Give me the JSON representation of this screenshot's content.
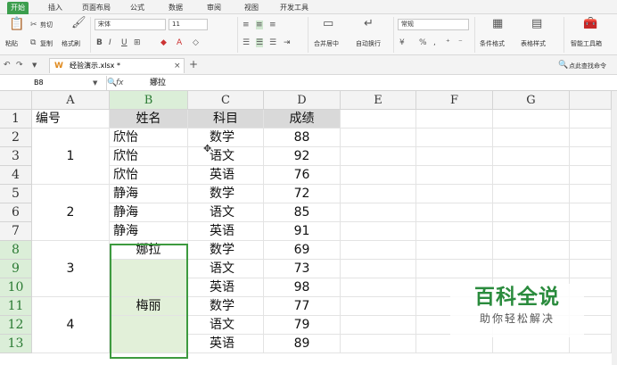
{
  "menu_tabs": [
    "开始",
    "插入",
    "页面布局",
    "公式",
    "数据",
    "审阅",
    "视图",
    "开发工具"
  ],
  "ribbon": {
    "cut": "剪切",
    "paste": "粘贴",
    "copy": "复制",
    "format_painter": "格式刷",
    "font_name": "宋体",
    "font_size": "11",
    "merge_center": "合并居中",
    "wrap_text": "自动换行",
    "number_format": "常规",
    "conditional_format": "条件格式",
    "table_style": "表格样式",
    "smart_toolbox": "智能工具箱"
  },
  "doc": {
    "filename": "经验演示.xlsx *",
    "search": "点此查找命令"
  },
  "formula_bar": {
    "cell_ref": "B8",
    "fx": "fx",
    "value": "娜拉"
  },
  "columns": [
    "A",
    "B",
    "C",
    "D",
    "E",
    "F",
    "G"
  ],
  "rows": [
    "1",
    "2",
    "3",
    "4",
    "5",
    "6",
    "7",
    "8",
    "9",
    "10",
    "11",
    "12",
    "13"
  ],
  "sheet": {
    "headers": [
      "编号",
      "姓名",
      "科目",
      "成绩"
    ],
    "a_groups": [
      "1",
      "2",
      "3",
      "4"
    ],
    "names": [
      "欣怡",
      "欣怡",
      "欣怡",
      "静海",
      "静海",
      "静海",
      "娜拉",
      "梅丽"
    ],
    "subjects": [
      "数学",
      "语文",
      "英语",
      "数学",
      "语文",
      "英语",
      "数学",
      "语文",
      "英语",
      "数学",
      "语文",
      "英语"
    ],
    "scores": [
      "88",
      "92",
      "76",
      "72",
      "85",
      "91",
      "69",
      "73",
      "98",
      "77",
      "79",
      "89"
    ]
  },
  "watermark": {
    "title": "百科全说",
    "subtitle": "助你轻松解决"
  },
  "colors": {
    "accent": "#3c9e4d",
    "selection": "#e2f0d9",
    "header_fill": "#d9d9d9"
  }
}
